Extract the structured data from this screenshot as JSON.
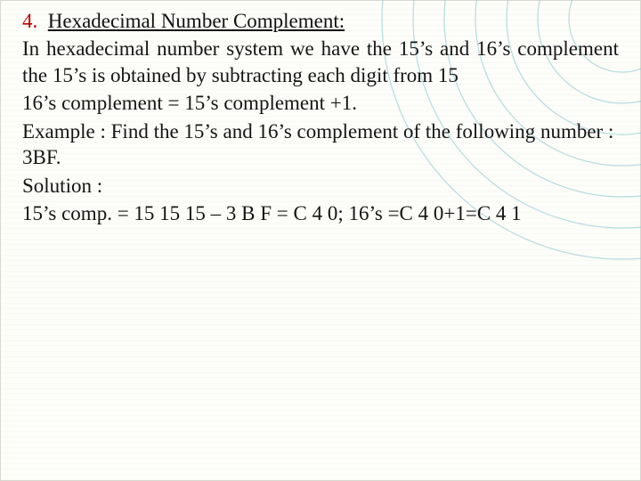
{
  "heading": {
    "num": "4.",
    "title": "Hexadecimal Number  Complement:"
  },
  "body": {
    "p1": "In hexadecimal number system we have the 15’s and 16’s complement the 15’s is obtained by subtracting each digit from 15",
    "p2": "16’s complement = 15’s complement +1.",
    "p3": "Example : Find the 15’s and 16’s complement of the following number : 3BF.",
    "p4": "Solution :",
    "p5": "15’s comp. = 15 15 15 – 3 B F = C 4 0; 16’s =C 4 0+1=C 4 1"
  }
}
